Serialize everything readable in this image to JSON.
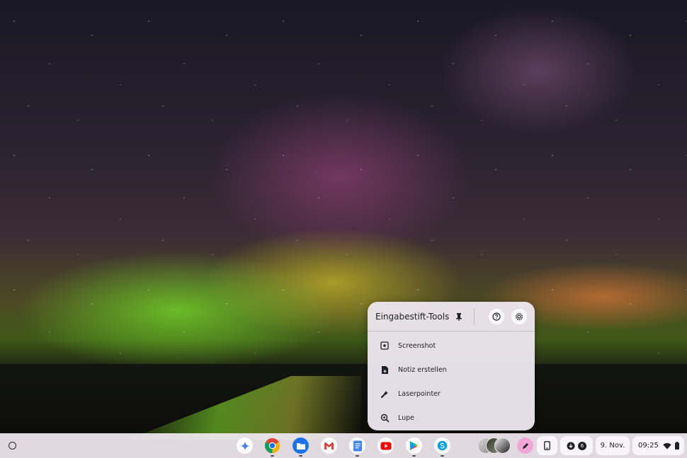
{
  "wallpaper": {
    "description_icon": "aurora-night-sky"
  },
  "pen_tools": {
    "title": "Eingabestift-Tools",
    "items": [
      {
        "label": "Screenshot",
        "icon": "screenshot-icon"
      },
      {
        "label": "Notiz erstellen",
        "icon": "note-icon"
      },
      {
        "label": "Laserpointer",
        "icon": "laser-pointer-icon"
      },
      {
        "label": "Lupe",
        "icon": "magnifier-icon"
      }
    ]
  },
  "shelf": {
    "apps": [
      "assistant",
      "chrome",
      "files",
      "gmail",
      "docs",
      "youtube",
      "play-store",
      "skype"
    ],
    "tray": {
      "downloads_count": "6",
      "date": "9. Nov.",
      "time": "09:25"
    }
  },
  "colors": {
    "accent_pink": "#f2a6d8",
    "chrome_red": "#db4437",
    "chrome_green": "#0f9d58",
    "chrome_yellow": "#f4b400",
    "blue": "#1a73e8",
    "youtube_red": "#ff0000",
    "skype_blue": "#0aa1e3"
  }
}
